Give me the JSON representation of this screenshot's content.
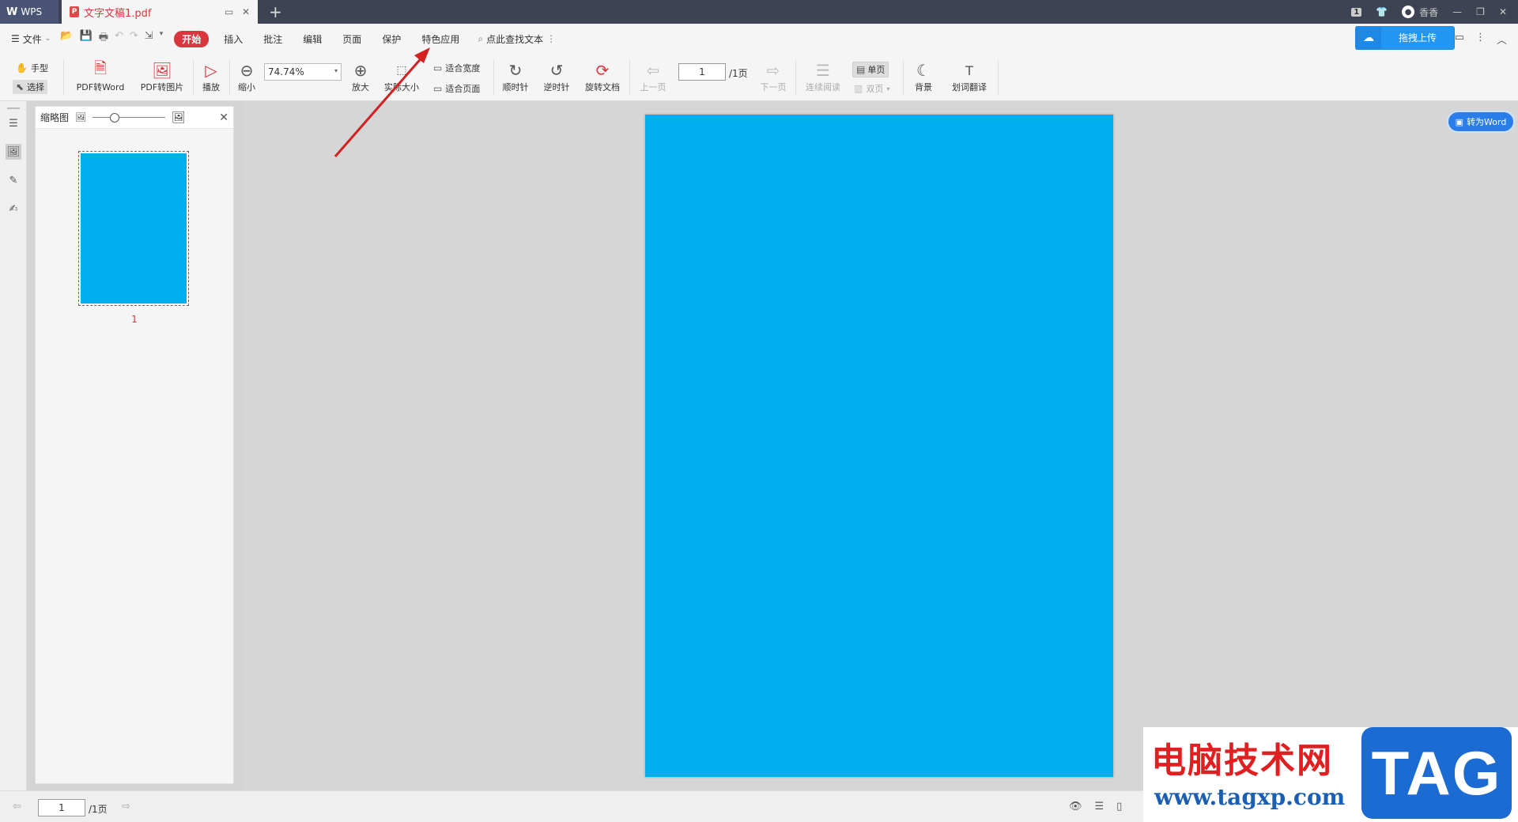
{
  "titlebar": {
    "app_name": "WPS",
    "doc_title": "文字文稿1.pdf",
    "page_count_badge": "1",
    "user_name": "香香",
    "new_tab": "+"
  },
  "menubar": {
    "file_label": "文件",
    "tabs": [
      "开始",
      "插入",
      "批注",
      "编辑",
      "页面",
      "保护",
      "特色应用"
    ],
    "active_tab": "开始",
    "search_label": "点此查找文本",
    "upload_label": "拖拽上传"
  },
  "toolbar": {
    "hand_label": "手型",
    "select_label": "选择",
    "pdf_to_word": "PDF转Word",
    "pdf_to_image": "PDF转图片",
    "play": "播放",
    "zoom_out": "缩小",
    "zoom_value": "74.74%",
    "zoom_in": "放大",
    "actual_size": "实际大小",
    "fit_width": "适合宽度",
    "fit_page": "适合页面",
    "clockwise": "顺时针",
    "counter_clockwise": "逆时针",
    "rotate_doc": "旋转文档",
    "prev_page": "上一页",
    "page_value": "1",
    "page_total": "/1页",
    "next_page": "下一页",
    "continuous": "连续阅读",
    "single_page": "单页",
    "double_page": "双页",
    "background": "背景",
    "translate": "划词翻译"
  },
  "thumbnail": {
    "title": "缩略图",
    "page_number": "1"
  },
  "document": {
    "page_color": "#03aeef",
    "to_word_label": "转为Word"
  },
  "statusbar": {
    "page_value": "1",
    "page_total": "/1页"
  },
  "watermark": {
    "cn_text": "电脑技术网",
    "url": "www.tagxp.com",
    "tag": "TAG"
  }
}
